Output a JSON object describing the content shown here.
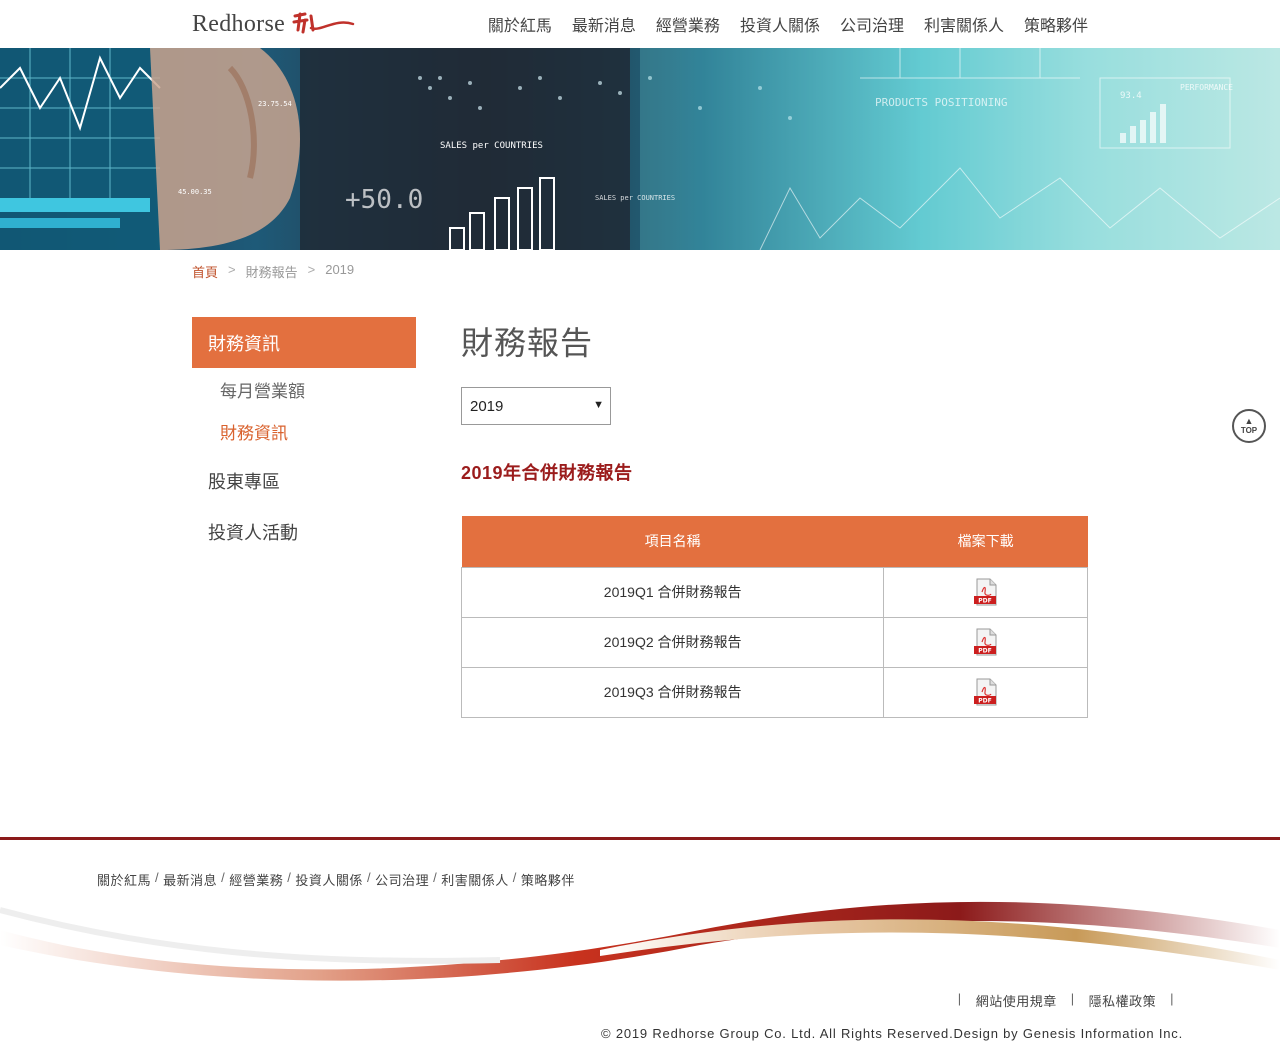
{
  "header": {
    "logo_text": "Redhorse",
    "nav": [
      "關於紅馬",
      "最新消息",
      "經營業務",
      "投資人關係",
      "公司治理",
      "利害關係人",
      "策略夥伴"
    ]
  },
  "banner": {
    "labels": [
      "SALES per COUNTRIES",
      "+50.0",
      "PRODUCTS POSITIONING",
      "PERFORMANCE",
      "SALES per COUNTRIES",
      "23.75.54",
      "45.00.35",
      "93.4"
    ]
  },
  "breadcrumb": {
    "home": "首頁",
    "sep": ">",
    "level1": "財務報告",
    "level2": "2019"
  },
  "sidebar": {
    "header": "財務資訊",
    "sub_items": [
      "每月營業額",
      "財務資訊"
    ],
    "main_items": [
      "股東專區",
      "投資人活動"
    ]
  },
  "content": {
    "page_title": "財務報告",
    "year_select": "2019",
    "report_title": "2019年合併財務報告",
    "table": {
      "headers": [
        "項目名稱",
        "檔案下載"
      ],
      "rows": [
        "2019Q1 合併財務報告",
        "2019Q2 合併財務報告",
        "2019Q3 合併財務報告"
      ],
      "pdf_label": "PDF"
    }
  },
  "top_button": {
    "arrow": "▲",
    "label": "TOP"
  },
  "footer": {
    "links": [
      "關於紅馬",
      "最新消息",
      "經營業務",
      "投資人關係",
      "公司治理",
      "利害關係人",
      "策略夥伴"
    ],
    "slash": "/",
    "policy": [
      "網站使用規章",
      "隱私權政策"
    ],
    "policy_sep": "|",
    "copyright": "© 2019 Redhorse Group Co. Ltd. All Rights Reserved.Design by Genesis Information Inc."
  },
  "colors": {
    "accent_orange": "#e3703f",
    "title_red": "#9b1c1c",
    "footer_line": "#8b1a1a"
  }
}
